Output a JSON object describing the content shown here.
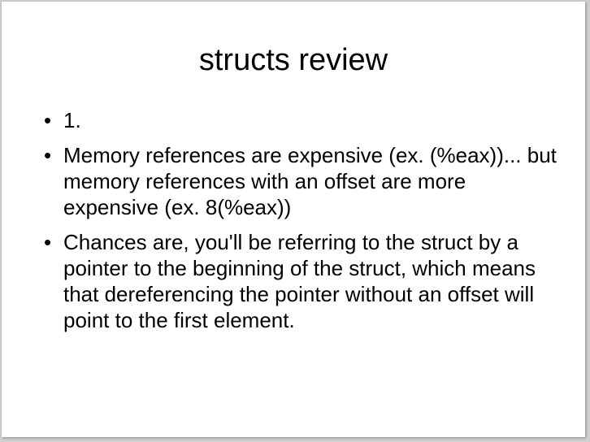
{
  "slide": {
    "title": "structs review",
    "bullet_glyph": "•",
    "bullets": [
      {
        "text": "1."
      },
      {
        "text": "Memory references are expensive (ex. (%eax))... but memory references with an offset are more expensive (ex. 8(%eax))"
      },
      {
        "text": "Chances are, you'll be referring to the struct by a pointer to the beginning of the struct, which means that dereferencing the pointer without an offset will point to the first element."
      }
    ]
  }
}
